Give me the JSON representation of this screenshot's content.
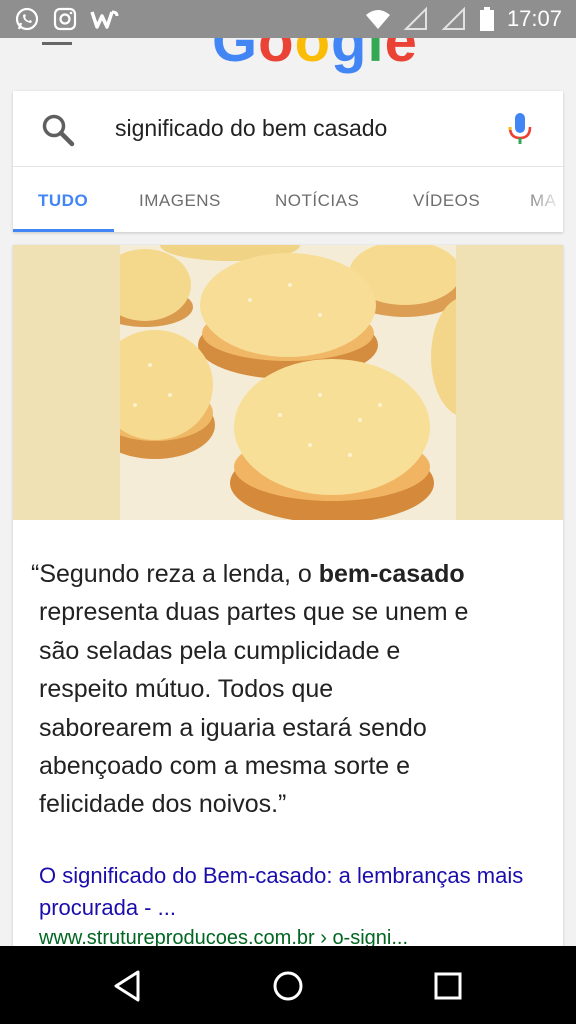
{
  "status_bar": {
    "time": "17:07",
    "icons": [
      "whatsapp-icon",
      "instagram-icon",
      "w-app-icon",
      "wifi-icon",
      "signal-icon",
      "signal-icon",
      "battery-icon"
    ]
  },
  "google": {
    "logo_letters": [
      "G",
      "o",
      "o",
      "g",
      "l",
      "e"
    ],
    "logo_colors": [
      "#4285f4",
      "#ea4335",
      "#fbbc05",
      "#4285f4",
      "#34a853",
      "#ea4335"
    ]
  },
  "search": {
    "query": "significado do bem casado"
  },
  "tabs": [
    {
      "label": "TUDO",
      "active": true
    },
    {
      "label": "IMAGENS",
      "active": false
    },
    {
      "label": "NOTÍCIAS",
      "active": false
    },
    {
      "label": "VÍDEOS",
      "active": false
    },
    {
      "label": "MA",
      "active": false
    }
  ],
  "result": {
    "image_description_icon": "bem-casado-cookies-image",
    "quote": {
      "open": "“Segundo reza a lenda, o ",
      "bold": "bem-casado",
      "lines": [
        "representa duas partes que se unem e",
        "são seladas pela cumplicidade e",
        "respeito mútuo. Todos que",
        "saborearem a iguaria estará sendo",
        "abençoado com a mesma sorte e",
        "felicidade dos noivos.”"
      ]
    },
    "link_title": "O significado do Bem-casado: a lembranças mais procurada - ...",
    "link_url": "www.strutureproducoes.com.br › o-signi..."
  },
  "colors": {
    "accent": "#4285f4",
    "link": "#1a0dab",
    "url": "#006621",
    "status_bar": "#8f8f8f"
  }
}
